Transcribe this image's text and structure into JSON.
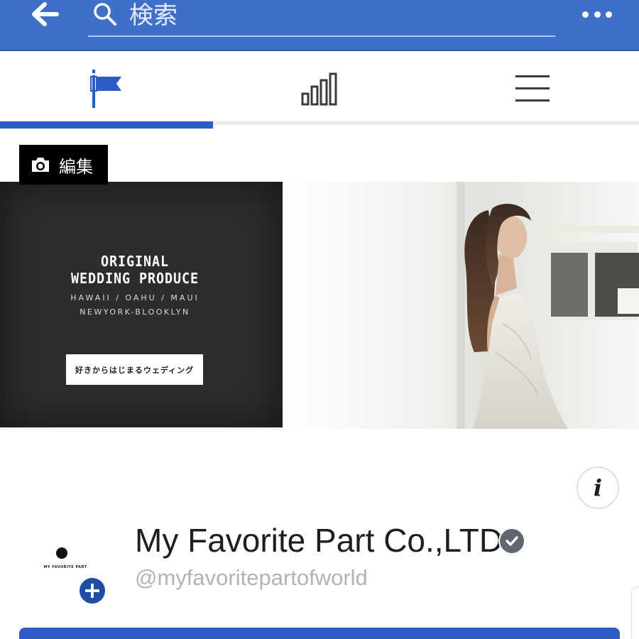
{
  "topbar": {
    "search_placeholder": "検索",
    "back_icon": "back-arrow-icon",
    "search_icon": "search-icon",
    "more_icon": "more-dots-icon",
    "background": "#3f6fc9"
  },
  "tabs": [
    {
      "icon": "flag-icon",
      "active": true
    },
    {
      "icon": "bar-chart-icon",
      "active": false
    },
    {
      "icon": "hamburger-menu-icon",
      "active": false
    }
  ],
  "cover": {
    "edit_label": "編集",
    "headline_line1": "ORIGINAL",
    "headline_line2": "WEDDING PRODUCE",
    "locations_line1": "HAWAII / OAHU / MAUI",
    "locations_line2": "NEWYORK-BLOOKLYN",
    "cta_label": "好きからはじまるウェディング"
  },
  "profile": {
    "name": "My Favorite Part Co.,LTD.",
    "handle": "@myfavoritepartofworld",
    "avatar_text": "MY FAVORITE PART",
    "verified_icon": "verified-check-icon",
    "add_icon": "plus-icon",
    "info_icon": "info-icon"
  },
  "colors": {
    "brand_blue": "#2d5cc4",
    "verified_grey": "#606770"
  }
}
